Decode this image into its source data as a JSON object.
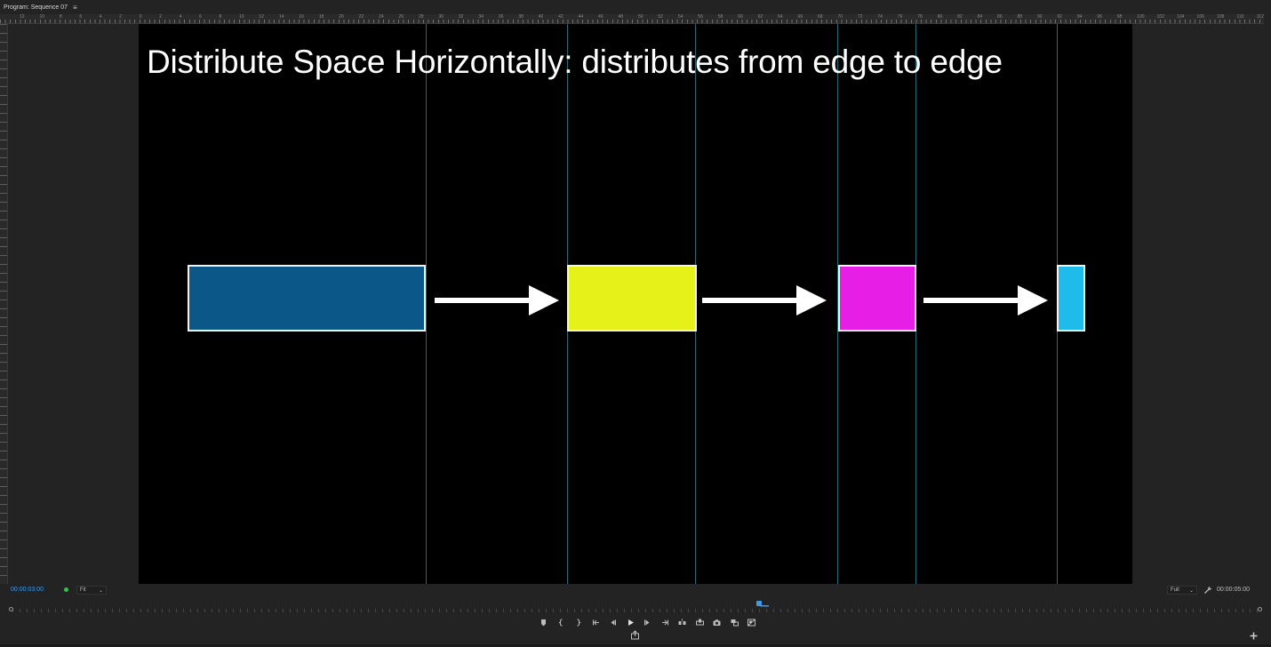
{
  "panel": {
    "title": "Program: Sequence 07",
    "menu_icon": "hamburger-menu-icon"
  },
  "ruler": {
    "top_labels": [
      "12",
      "10",
      "8",
      "6",
      "4",
      "2",
      "0",
      "2",
      "4",
      "6",
      "8",
      "10",
      "12",
      "14",
      "16",
      "18",
      "20",
      "22",
      "24",
      "26",
      "28",
      "30",
      "32",
      "34",
      "36",
      "38",
      "40",
      "42",
      "44",
      "46",
      "48",
      "50",
      "52",
      "54",
      "56",
      "58",
      "60",
      "62",
      "64",
      "66",
      "68",
      "70",
      "72",
      "74",
      "76",
      "78",
      "80",
      "82",
      "84",
      "86",
      "88",
      "90",
      "92",
      "94",
      "96",
      "98",
      "100",
      "102",
      "104",
      "106",
      "108",
      "110",
      "112"
    ]
  },
  "canvas": {
    "title": "Distribute Space Horizontally: distributes from edge to edge",
    "shapes": [
      {
        "name": "blue-rectangle",
        "fill": "#0b5788"
      },
      {
        "name": "yellow-rectangle",
        "fill": "#e6f019"
      },
      {
        "name": "magenta-rectangle",
        "fill": "#e61ee6"
      },
      {
        "name": "cyan-rectangle",
        "fill": "#1fbbea"
      }
    ],
    "guide_color": "#1e6c78",
    "background": "#000000"
  },
  "controls": {
    "current_timecode": "00:00:03:00",
    "zoom_select": "Fit",
    "resolution_select": "Full",
    "duration_timecode": "00:00:05:00",
    "accent_color": "#3c9ae8",
    "transport_buttons": [
      "add-marker-icon",
      "mark-in-icon",
      "mark-out-icon",
      "go-to-in-icon",
      "step-back-icon",
      "play-icon",
      "step-forward-icon",
      "go-to-out-icon",
      "insert-icon",
      "overwrite-icon",
      "export-frame-icon",
      "comparison-view-icon",
      "toggle-proxies-icon"
    ]
  }
}
